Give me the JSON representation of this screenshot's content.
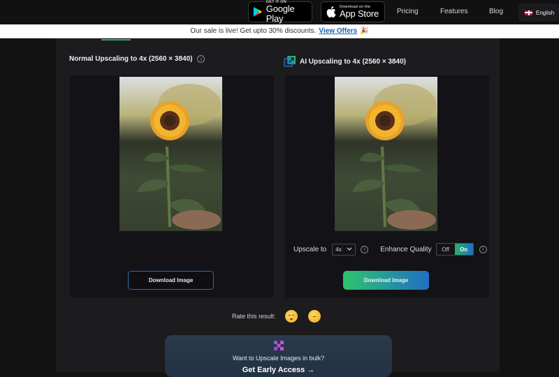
{
  "header": {
    "google_play": {
      "small": "GET IT ON",
      "big": "Google Play"
    },
    "app_store": {
      "small": "Download on the",
      "big": "App Store"
    },
    "nav": [
      "Pricing",
      "Features",
      "Blog"
    ],
    "language": "English"
  },
  "banner": {
    "text": "Our sale is live! Get upto 30% discounts.",
    "link": "View Offers",
    "emoji": "🎉"
  },
  "normal": {
    "title": "Normal Upscaling to 4x (2560 × 3840)",
    "download_label": "Download Image"
  },
  "ai": {
    "title": "AI Upscaling to 4x (2560 × 3840)",
    "upscale_label": "Upscale to",
    "upscale_value": "4x",
    "enhance_label": "Enhance Quality",
    "toggle_off": "Off",
    "toggle_on": "On",
    "toggle_state": "On",
    "download_label": "Download Image"
  },
  "rating": {
    "label": "Rate this result:"
  },
  "bulk": {
    "question": "Want to Upscale Images in bulk?",
    "cta": "Get Early Access →"
  },
  "colors": {
    "accent_green": "#2ec56d",
    "accent_blue": "#1f6fc4",
    "link_blue": "#1a5fb4"
  }
}
